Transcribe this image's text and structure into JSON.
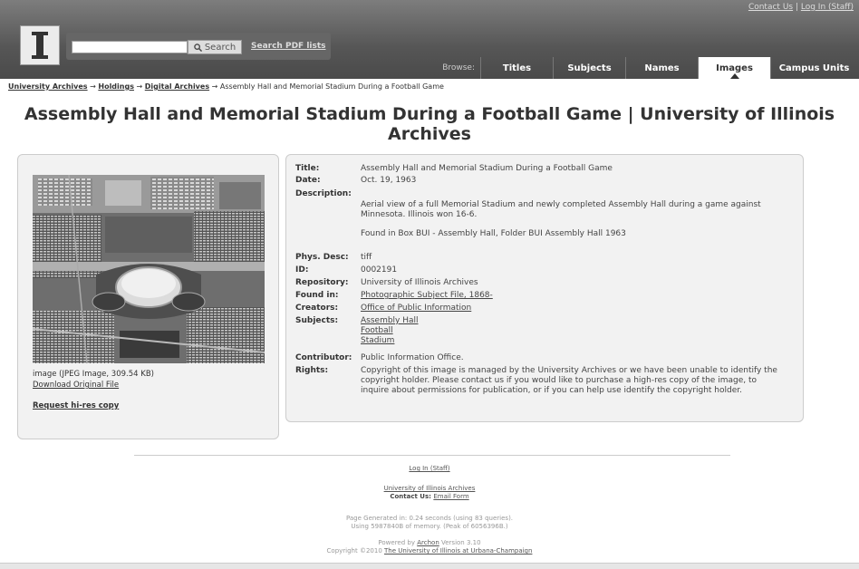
{
  "header": {
    "contact_label": "Contact Us",
    "login_label": "Log In (Staff)",
    "search_button": "Search",
    "search_pdf": "Search PDF lists",
    "browse_label": "Browse:",
    "tabs": [
      {
        "label": "Titles"
      },
      {
        "label": "Subjects"
      },
      {
        "label": "Names"
      },
      {
        "label": "Images"
      },
      {
        "label": "Campus Units"
      }
    ]
  },
  "breadcrumb": {
    "items": [
      "University Archives",
      "Holdings",
      "Digital Archives"
    ],
    "current": "Assembly Hall and Memorial Stadium During a Football Game"
  },
  "page_title": "Assembly Hall and Memorial Stadium During a Football Game | University of Illinois Archives",
  "image_panel": {
    "info": "image (JPEG Image, 309.54 KB)",
    "download": "Download Original File",
    "request": "Request hi-res copy"
  },
  "record": {
    "title_label": "Title:",
    "title": "Assembly Hall and Memorial Stadium During a Football Game",
    "date_label": "Date:",
    "date": "Oct. 19, 1963",
    "description_label": "Description:",
    "description": "Aerial view of a full Memorial Stadium and newly completed Assembly Hall during a game against Minnesota. Illinois won 16-6.",
    "description_box": "Found in Box BUI - Assembly Hall, Folder BUI Assembly Hall 1963",
    "phys_label": "Phys. Desc:",
    "phys": "tiff",
    "id_label": "ID:",
    "id": "0002191",
    "repo_label": "Repository:",
    "repo": "University of Illinois Archives",
    "found_label": "Found in:",
    "found": "Photographic Subject File, 1868-",
    "creators_label": "Creators:",
    "creators": "Office of Public Information",
    "subjects_label": "Subjects:",
    "subjects": [
      "Assembly Hall",
      "Football",
      "Stadium"
    ],
    "contributor_label": "Contributor:",
    "contributor": "Public Information Office.",
    "rights_label": "Rights:",
    "rights": "Copyright of this image is managed by the University Archives or we have been unable to identify the copyright holder. Please contact us if you would like to purchase a high-res copy of the image, to inquire about permissions for publication, or if you can help use identify the copyright holder."
  },
  "footer": {
    "login": "Log In (Staff)",
    "archives_link": "University of Illinois Archives",
    "contact_prefix": "Contact Us:",
    "contact_link": "Email Form",
    "generated": "Page Generated in: 0.24 seconds (using 83 queries).",
    "memory": "Using 5987840B of memory. (Peak of 6056396B.)",
    "powered_prefix": "Powered by",
    "powered_link": "Archon",
    "powered_suffix": "Version 3.10",
    "copyright_prefix": "Copyright ©2010",
    "copyright_link": "The University of Illinois at Urbana-Champaign"
  }
}
